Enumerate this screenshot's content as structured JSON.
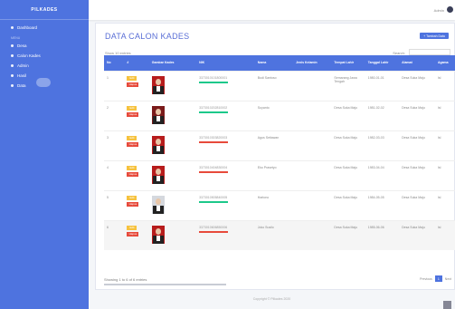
{
  "sidebar": {
    "brand": "PILKADES",
    "dashboard": "Dashboard",
    "heading": "Menu",
    "items": [
      {
        "label": "Desa"
      },
      {
        "label": "Calon Kades"
      },
      {
        "label": "Admin"
      },
      {
        "label": "Hasil"
      },
      {
        "label": "Data"
      }
    ]
  },
  "topbar": {
    "user": "Admin"
  },
  "card": {
    "title": "DATA CALON KADES",
    "add_label": "+ Tambah Data",
    "show_text": "Show 10 entries",
    "search_label": "Search:",
    "search_value": ""
  },
  "table": {
    "headers": [
      "No",
      "#",
      "Gambar Kades",
      "NIK",
      "Nama",
      "Jenis Kelamin",
      "Tempat Lahir",
      "Tanggal Lahir",
      "Alamat",
      "Agama"
    ],
    "rows": [
      {
        "no": "1",
        "nik": "3373010101800001",
        "name": "Budi Santoso",
        "tempat": "Semarang Jawa Tengah",
        "tanggal": "1980-01-01",
        "alamat": "Desa Suka Maju",
        "agama": "Isl"
      },
      {
        "no": "2",
        "nik": "3373010202810002",
        "name": "Suyanto",
        "tempat": "Desa Suka Maju",
        "tanggal": "1981-02-02",
        "alamat": "Desa Suka Maju",
        "agama": "Isl"
      },
      {
        "no": "3",
        "nik": "3373010303820003",
        "name": "Agus Setiawan",
        "tempat": "Desa Suka Maju",
        "tanggal": "1982-03-03",
        "alamat": "Desa Suka Maju",
        "agama": "Isl"
      },
      {
        "no": "4",
        "nik": "3373010404830004",
        "name": "Eko Prasetyo",
        "tempat": "Desa Suka Maju",
        "tanggal": "1983-04-04",
        "alamat": "Desa Suka Maju",
        "agama": "Isl"
      },
      {
        "no": "5",
        "nik": "3373010505840005",
        "name": "Hartono",
        "tempat": "Desa Suka Maju",
        "tanggal": "1984-05-05",
        "alamat": "Desa Suka Maju",
        "agama": "Isl"
      },
      {
        "no": "6",
        "nik": "3373010606850006",
        "name": "Joko Susilo",
        "tempat": "Desa Suka Maju",
        "tanggal": "1985-06-06",
        "alamat": "Desa Suka Maju",
        "agama": "Isl"
      }
    ],
    "edit_label": "Edit",
    "delete_label": "Hapus"
  },
  "info": "Showing 1 to 6 of 6 entries",
  "pager": {
    "prev": "Previous",
    "page": "1",
    "next": "Next"
  },
  "footer": "Copyright © Pilkades 2020",
  "colors": {
    "primary": "#4e73df",
    "warning": "#f6c23e",
    "danger": "#e74a3b",
    "success": "#1cc88a"
  }
}
